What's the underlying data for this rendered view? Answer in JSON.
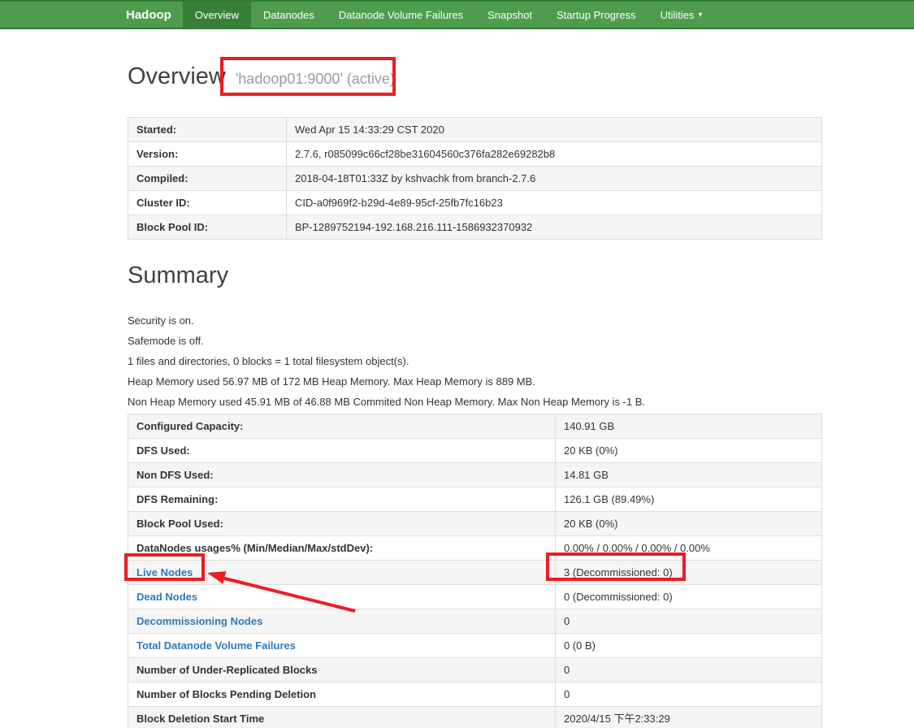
{
  "theme": {
    "navbar_bg": "#4e9c4e",
    "navbar_active": "#38803a",
    "navbar_border": "#2e7d32",
    "link_blue": "#2e79b9",
    "stripe_gray": "#f5f5f5",
    "annotation_red": "#ed1c24"
  },
  "navbar": {
    "brand": "Hadoop",
    "active_item": "Overview",
    "caret": "▾",
    "items": [
      "Overview",
      "Datanodes",
      "Datanode Volume Failures",
      "Snapshot",
      "Startup Progress",
      "Utilities"
    ]
  },
  "page": {
    "title": "Overview",
    "subtitle": "'hadoop01:9000' (active)"
  },
  "info_table": {
    "rows": [
      {
        "label": "Started:",
        "value": "Wed Apr 15 14:33:29 CST 2020"
      },
      {
        "label": "Version:",
        "value": "2.7.6, r085099c66cf28be31604560c376fa282e69282b8"
      },
      {
        "label": "Compiled:",
        "value": "2018-04-18T01:33Z by kshvachk from branch-2.7.6"
      },
      {
        "label": "Cluster ID:",
        "value": "CID-a0f969f2-b29d-4e89-95cf-25fb7fc16b23"
      },
      {
        "label": "Block Pool ID:",
        "value": "BP-1289752194-192.168.216.111-1586932370932"
      }
    ]
  },
  "summary": {
    "title": "Summary",
    "lines": [
      "Security is on.",
      "Safemode is off.",
      "1 files and directories, 0 blocks = 1 total filesystem object(s).",
      "Heap Memory used 56.97 MB of 172 MB Heap Memory. Max Heap Memory is 889 MB.",
      "Non Heap Memory used 45.91 MB of 46.88 MB Commited Non Heap Memory. Max Non Heap Memory is -1 B."
    ]
  },
  "summary_table": {
    "rows": [
      {
        "label": "Configured Capacity:",
        "value": "140.91 GB",
        "link": false
      },
      {
        "label": "DFS Used:",
        "value": "20 KB (0%)",
        "link": false
      },
      {
        "label": "Non DFS Used:",
        "value": "14.81 GB",
        "link": false
      },
      {
        "label": "DFS Remaining:",
        "value": "126.1 GB (89.49%)",
        "link": false
      },
      {
        "label": "Block Pool Used:",
        "value": "20 KB (0%)",
        "link": false
      },
      {
        "label": "DataNodes usages% (Min/Median/Max/stdDev):",
        "value": "0.00% / 0.00% / 0.00% / 0.00%",
        "link": false
      },
      {
        "label": "Live Nodes",
        "value": "3 (Decommissioned: 0)",
        "link": true
      },
      {
        "label": "Dead Nodes",
        "value": "0 (Decommissioned: 0)",
        "link": true
      },
      {
        "label": "Decommissioning Nodes",
        "value": "0",
        "link": true
      },
      {
        "label": "Total Datanode Volume Failures",
        "value": "0 (0 B)",
        "link": true
      },
      {
        "label": "Number of Under-Replicated Blocks",
        "value": "0",
        "link": false
      },
      {
        "label": "Number of Blocks Pending Deletion",
        "value": "0",
        "link": false
      },
      {
        "label": "Block Deletion Start Time",
        "value": "2020/4/15 下午2:33:29",
        "link": false
      }
    ]
  },
  "annotations": {
    "color": "#ed1c24",
    "boxes": [
      "title-host",
      "live-nodes-label",
      "live-nodes-value"
    ],
    "arrow": "points to Live Nodes"
  }
}
